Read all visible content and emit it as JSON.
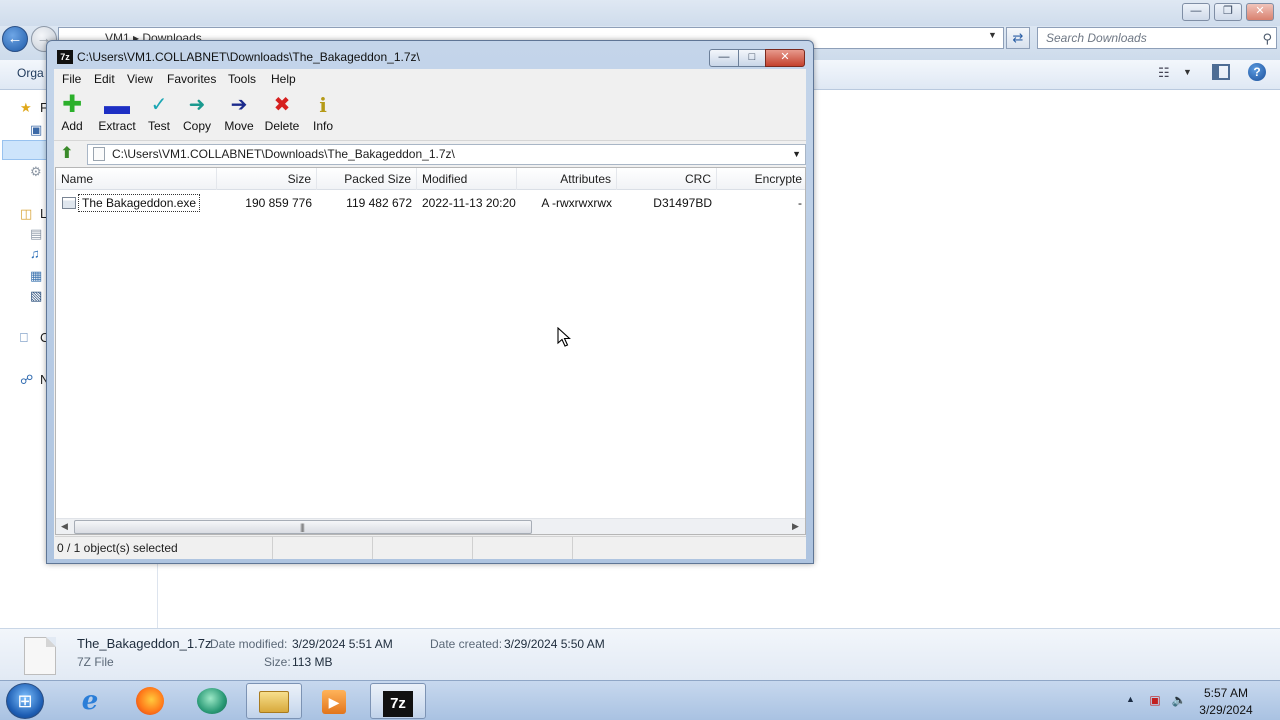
{
  "explorer": {
    "breadcrumb": [
      "VM1",
      "Downloads"
    ],
    "search_placeholder": "Search Downloads",
    "organize_label": "Orga",
    "navpane_letters": [
      "F",
      "L",
      "C",
      "N"
    ],
    "details": {
      "file_name": "The_Bakageddon_1.7z",
      "file_type": "7Z File",
      "date_modified_label": "Date modified:",
      "date_modified_value": "3/29/2024 5:51 AM",
      "date_created_label": "Date created:",
      "date_created_value": "3/29/2024 5:50 AM",
      "size_label": "Size:",
      "size_value": "113 MB"
    }
  },
  "sevenzip": {
    "title": "C:\\Users\\VM1.COLLABNET\\Downloads\\The_Bakageddon_1.7z\\",
    "title_icon": "7z",
    "menu": [
      "File",
      "Edit",
      "View",
      "Favorites",
      "Tools",
      "Help"
    ],
    "toolbar": [
      {
        "label": "Add",
        "icon": "add-icon",
        "color": "#2bb02b"
      },
      {
        "label": "Extract",
        "icon": "extract-icon",
        "color": "#1d2fc4"
      },
      {
        "label": "Test",
        "icon": "test-icon",
        "color": "#1aa6b3"
      },
      {
        "label": "Copy",
        "icon": "copy-icon",
        "color": "#1a9a8f"
      },
      {
        "label": "Move",
        "icon": "move-icon",
        "color": "#1b2a8c"
      },
      {
        "label": "Delete",
        "icon": "delete-icon",
        "color": "#d6201f"
      },
      {
        "label": "Info",
        "icon": "info-icon",
        "color": "#b59a17"
      }
    ],
    "path": "C:\\Users\\VM1.COLLABNET\\Downloads\\The_Bakageddon_1.7z\\",
    "columns": [
      "Name",
      "Size",
      "Packed Size",
      "Modified",
      "Attributes",
      "CRC",
      "Encrypte"
    ],
    "rows": [
      {
        "name": "The Bakageddon.exe",
        "size": "190 859 776",
        "packed_size": "119 482 672",
        "modified": "2022-11-13 20:20",
        "attributes": "A -rwxrwxrwx",
        "crc": "D31497BD",
        "encrypted": "-"
      }
    ],
    "status": "0 / 1 object(s) selected"
  },
  "taskbar": {
    "time": "5:57 AM",
    "date": "3/29/2024",
    "pinned": [
      "internet-explorer-icon",
      "firefox-icon",
      "app-icon",
      "file-explorer-icon",
      "media-player-icon",
      "7zip-icon"
    ],
    "active_app_label": "7z"
  }
}
